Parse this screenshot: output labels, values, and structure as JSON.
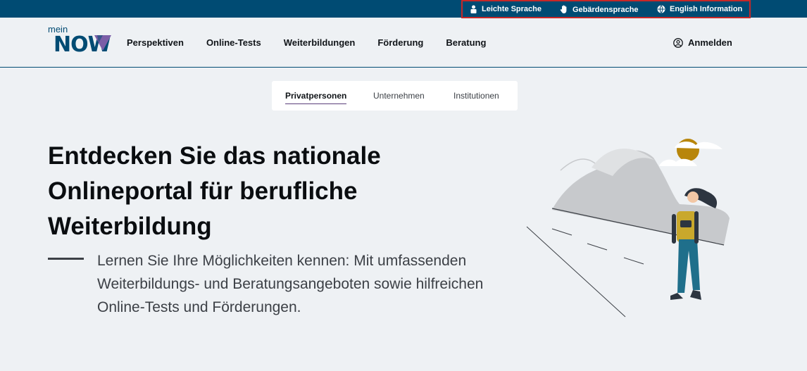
{
  "utility_bar": {
    "items": [
      {
        "label": "Leichte Sprache",
        "icon": "person-icon"
      },
      {
        "label": "Gebärdensprache",
        "icon": "hand-icon"
      },
      {
        "label": "English Information",
        "icon": "globe-icon"
      }
    ]
  },
  "header": {
    "logo": {
      "mein": "mein",
      "now": "NOW"
    },
    "nav": [
      {
        "label": "Perspektiven"
      },
      {
        "label": "Online-Tests"
      },
      {
        "label": "Weiterbildungen"
      },
      {
        "label": "Förderung"
      },
      {
        "label": "Beratung"
      }
    ],
    "login": {
      "label": "Anmelden",
      "icon": "user-circle-icon"
    }
  },
  "audience_tabs": [
    {
      "label": "Privatpersonen",
      "active": true
    },
    {
      "label": "Unternehmen",
      "active": false
    },
    {
      "label": "Institutionen",
      "active": false
    }
  ],
  "hero": {
    "title": "Entdecken Sie das nationale Onlineportal für berufliche Weiterbildung",
    "text": "Lernen Sie Ihre Möglichkeiten kennen: Mit umfassenden Weiterbildungs- und Beratungsangeboten sowie hilfreichen Online-Tests und Förderungen."
  },
  "colors": {
    "brand": "#004b73",
    "accent_purple": "#7b5ea7",
    "highlight_border": "#c62828",
    "sun": "#b8860b"
  }
}
